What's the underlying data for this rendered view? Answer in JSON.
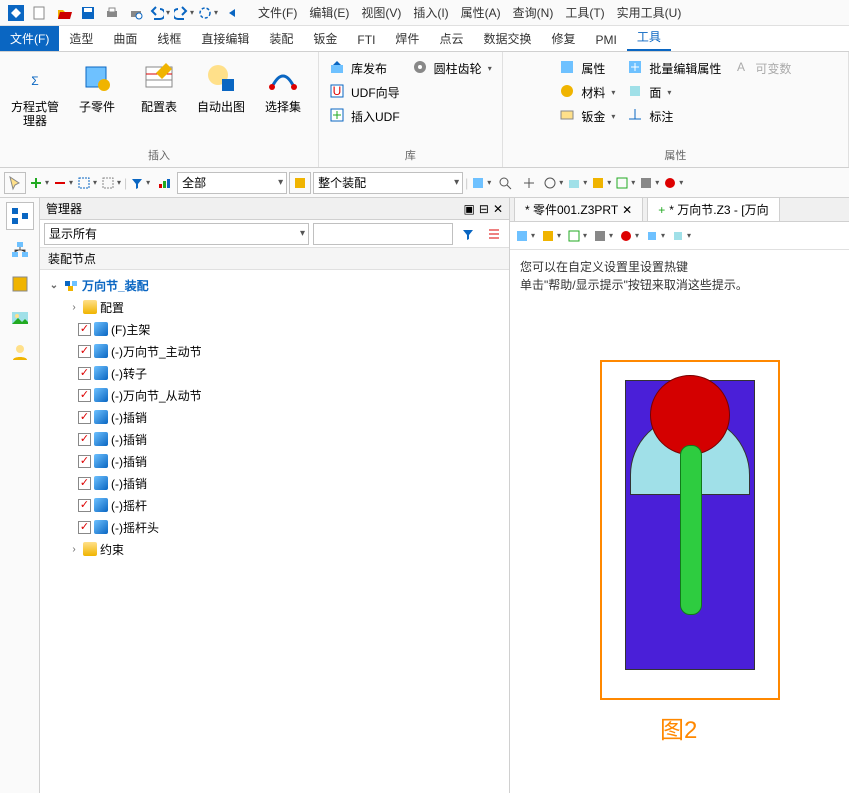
{
  "qat_menu": [
    "文件(F)",
    "编辑(E)",
    "视图(V)",
    "插入(I)",
    "属性(A)",
    "查询(N)",
    "工具(T)",
    "实用工具(U)"
  ],
  "ribbon_tabs": [
    "文件(F)",
    "造型",
    "曲面",
    "线框",
    "直接编辑",
    "装配",
    "钣金",
    "FTI",
    "焊件",
    "点云",
    "数据交换",
    "修复",
    "PMI",
    "工具"
  ],
  "ribbon": {
    "group1": {
      "label": "插入",
      "btns": [
        "方程式管理器",
        "子零件",
        "配置表",
        "自动出图",
        "选择集"
      ]
    },
    "group2": {
      "label": "库",
      "rows": [
        "库发布",
        "UDF向导",
        "插入UDF"
      ],
      "extra": "圆柱齿轮"
    },
    "group3": {
      "label": "属性",
      "rows": [
        [
          "属性",
          "批量编辑属性",
          "可变数"
        ],
        [
          "材料",
          "面"
        ],
        [
          "钣金",
          "标注"
        ]
      ]
    }
  },
  "toolbar2": {
    "combo1": "全部",
    "combo2": "整个装配"
  },
  "panel": {
    "title": "管理器",
    "filter": "显示所有",
    "section": "装配节点",
    "root": "万向节_装配",
    "config": "配置",
    "items": [
      "(F)主架",
      "(-)万向节_主动节",
      "(-)转子",
      "(-)万向节_从动节",
      "(-)插销",
      "(-)插销",
      "(-)插销",
      "(-)插销",
      "(-)摇杆",
      "(-)摇杆头"
    ],
    "constraint": "约束"
  },
  "docs": {
    "tab1": "* 零件001.Z3PRT",
    "tab2": "* 万向节.Z3 - [万向"
  },
  "viewport": {
    "hint1": "您可以在自定义设置里设置热键",
    "hint2": "单击\"帮助/显示提示\"按钮来取消这些提示。",
    "fig": "图2"
  }
}
